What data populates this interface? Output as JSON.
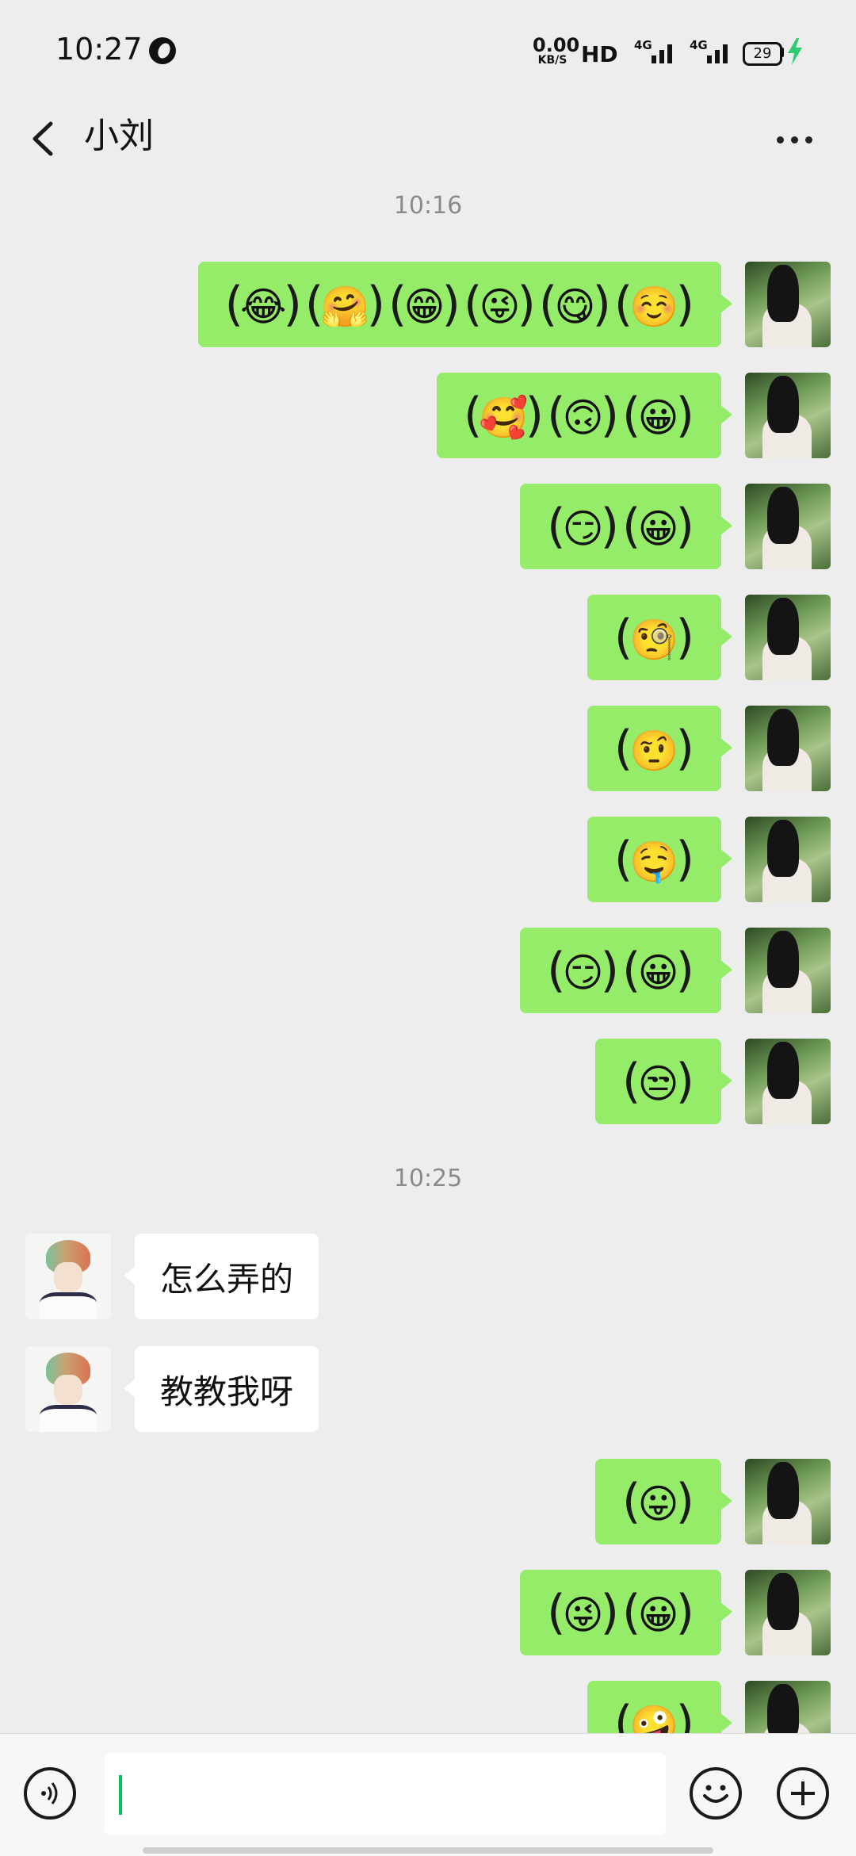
{
  "status_bar": {
    "time": "10:27",
    "net_speed_value": "0.00",
    "net_speed_unit": "KB/S",
    "hd_label": "HD",
    "signal1_label": "4G",
    "signal2_label": "4G",
    "battery_level": "29",
    "charging_color": "#2ecc71"
  },
  "header": {
    "title": "小刘",
    "back_icon": "chevron-left-icon",
    "more_icon": "more-icon"
  },
  "timestamps": [
    "10:16",
    "10:25"
  ],
  "messages": [
    {
      "from": "me",
      "emojis": [
        "😂",
        "🤗",
        "😁",
        "😜",
        "😋",
        "☺️"
      ]
    },
    {
      "from": "me",
      "emojis": [
        "🥰",
        "🙃",
        "😀"
      ]
    },
    {
      "from": "me",
      "emojis": [
        "😏",
        "😀"
      ]
    },
    {
      "from": "me",
      "emojis": [
        "🧐"
      ]
    },
    {
      "from": "me",
      "emojis": [
        "🤨"
      ]
    },
    {
      "from": "me",
      "emojis": [
        "🤤"
      ]
    },
    {
      "from": "me",
      "emojis": [
        "😏",
        "😀"
      ]
    },
    {
      "from": "me",
      "emojis": [
        "😒"
      ]
    },
    {
      "from": "them",
      "text": "怎么弄的"
    },
    {
      "from": "them",
      "text": "教教我呀"
    },
    {
      "from": "me",
      "emojis": [
        "😛"
      ]
    },
    {
      "from": "me",
      "emojis": [
        "😜",
        "😀"
      ]
    },
    {
      "from": "me",
      "emojis": [
        "🤪"
      ]
    }
  ],
  "input_bar": {
    "placeholder": "",
    "voice_icon": "voice-icon",
    "emoji_icon": "emoji-icon",
    "plus_icon": "plus-icon"
  },
  "colors": {
    "sent_bubble": "#95ec69",
    "received_bubble": "#ffffff",
    "background": "#ededed",
    "caret": "#07c160"
  }
}
